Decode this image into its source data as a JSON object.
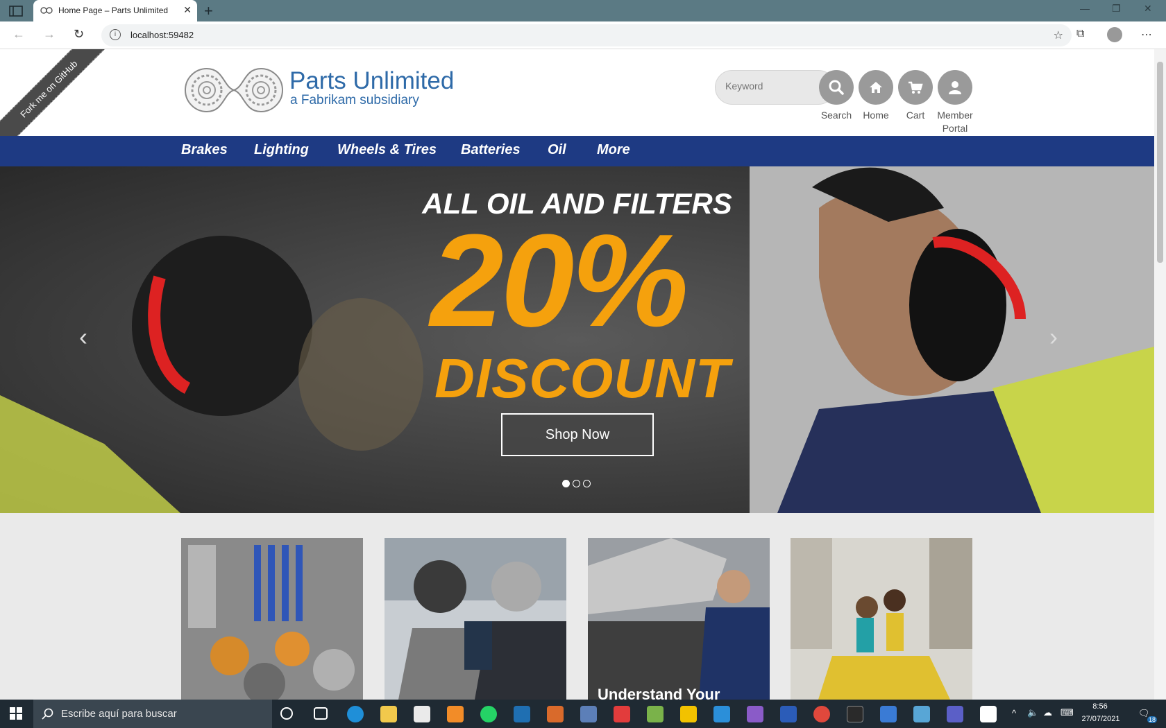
{
  "browser": {
    "tab_title": "Home Page – Parts Unlimited",
    "url": "localhost:59482"
  },
  "site": {
    "fork_ribbon": "Fork me on GitHub",
    "brand_title": "Parts Unlimited",
    "brand_subtitle": "a Fabrikam subsidiary",
    "search_placeholder": "Keyword",
    "header_buttons": [
      {
        "label": "Search"
      },
      {
        "label": "Home"
      },
      {
        "label": "Cart"
      },
      {
        "label": "Member Portal"
      }
    ],
    "categories": [
      "Brakes",
      "Lighting",
      "Wheels & Tires",
      "Batteries",
      "Oil",
      "More"
    ]
  },
  "hero": {
    "headline": "ALL OIL AND FILTERS",
    "percent": "20%",
    "discount": "DISCOUNT",
    "cta": "Shop Now",
    "slide_count": 3,
    "active_slide": 1
  },
  "tiles": [
    {
      "caption": ""
    },
    {
      "caption": ""
    },
    {
      "caption": "Understand Your"
    },
    {
      "caption": ""
    }
  ],
  "taskbar": {
    "search_placeholder": "Escribe aquí para buscar",
    "time": "8:56",
    "date": "27/07/2021",
    "notifications": "18"
  },
  "colors": {
    "nav_blue": "#1e3a83",
    "brand_blue": "#2e6aa8",
    "accent_orange": "#f5a10d",
    "tab_strip": "#5b7a84"
  }
}
